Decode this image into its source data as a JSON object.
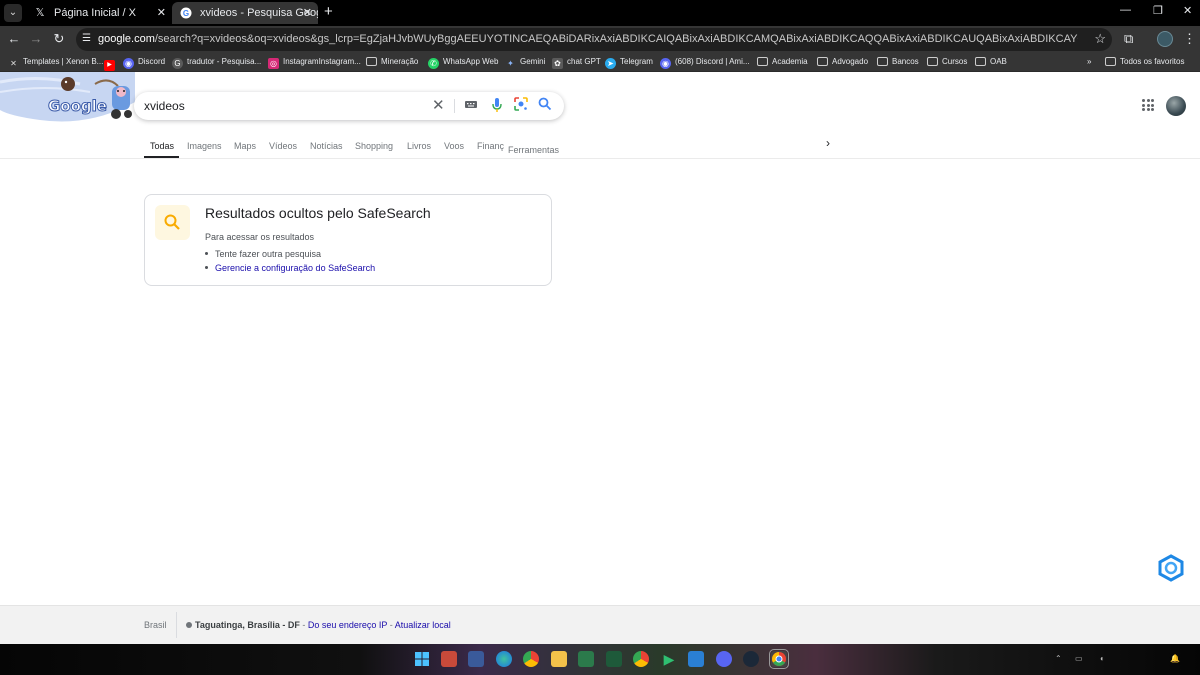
{
  "browser": {
    "tabs": [
      {
        "title": "Página Inicial / X",
        "favicon": "x-logo-icon"
      },
      {
        "title": "xvideos - Pesquisa Google",
        "favicon": "google-logo-icon"
      }
    ],
    "url_host": "google.com",
    "url_rest": "/search?q=xvideos&oq=xvideos&gs_lcrp=EgZjaHJvbWUyBggAEEUYOTINCAEQABiDARixAxiABDIKCAIQABixAxiABDIKCAMQABixAxiABDIKCAQQABixAxiABDIKCAUQABixAxiABDIKCAYQABixAxiABDIKCAcQABixAxiABDINCAgQABiDARixAxiABDIHCA...",
    "bookmarks": [
      {
        "label": "Templates | Xenon B...",
        "icon": "x-icon",
        "color": "#000000"
      },
      {
        "label": "",
        "icon": "youtube-icon",
        "color": "#ff0000"
      },
      {
        "label": "Discord",
        "icon": "discord-icon",
        "color": "#5865f2"
      },
      {
        "label": "tradutor - Pesquisa...",
        "icon": "google-icon",
        "color": "#4a4a4a"
      },
      {
        "label": "InstagramInstagram...",
        "icon": "instagram-icon",
        "color": "#d62976"
      },
      {
        "label": "Mineração",
        "icon": "folder-icon",
        "color": "transparent"
      },
      {
        "label": "WhatsApp Web",
        "icon": "whatsapp-icon",
        "color": "#25d366"
      },
      {
        "label": "Gemini",
        "icon": "gemini-icon",
        "color": "transparent"
      },
      {
        "label": "chat GPT",
        "icon": "chatgpt-icon",
        "color": "#4a4a4a"
      },
      {
        "label": "Telegram",
        "icon": "telegram-icon",
        "color": "#2aabee"
      },
      {
        "label": "(608) Discord | Ami...",
        "icon": "discord-icon",
        "color": "#5865f2"
      },
      {
        "label": "Academia",
        "icon": "folder-icon",
        "color": "transparent"
      },
      {
        "label": "Advogado",
        "icon": "folder-icon",
        "color": "transparent"
      },
      {
        "label": "Bancos",
        "icon": "folder-icon",
        "color": "transparent"
      },
      {
        "label": "Cursos",
        "icon": "folder-icon",
        "color": "transparent"
      },
      {
        "label": "OAB",
        "icon": "folder-icon",
        "color": "transparent"
      }
    ],
    "all_bookmarks": "Todos os favoritos"
  },
  "search": {
    "query": "xvideos",
    "logo_text": "Google"
  },
  "search_tabs": [
    "Todas",
    "Imagens",
    "Maps",
    "Vídeos",
    "Notícias",
    "Shopping",
    "Livros",
    "Voos",
    "Finanç"
  ],
  "tools_label": "Ferramentas",
  "safesearch": {
    "title": "Resultados ocultos pelo SafeSearch",
    "subtitle": "Para acessar os resultados",
    "item1": "Tente fazer outra pesquisa",
    "item2": "Gerencie a configuração do SafeSearch"
  },
  "footer": {
    "country": "Brasil",
    "location": "Taguatinga, Brasília - DF",
    "sep1": " - ",
    "ip_link": "Do seu endereço IP",
    "sep2": " - ",
    "update_link": "Atualizar local"
  },
  "colors": {
    "link": "#1a0dab",
    "google_blue": "#4285f4",
    "safesearch_icon_bg": "#fef7e0",
    "safesearch_icon": "#f9ab00"
  }
}
